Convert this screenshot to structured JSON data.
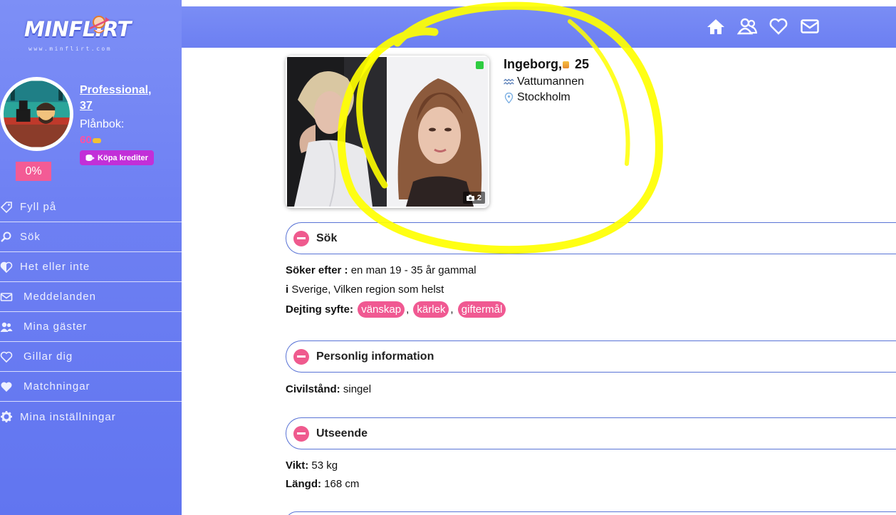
{
  "sidebar": {
    "logo": {
      "text": "MINFLIRT",
      "url": "www.minflirt.com"
    },
    "profile": {
      "name": "Professional, 37",
      "wallet_label": "Plånbok:",
      "wallet_value": "60",
      "buy_button": "Köpa krediter",
      "percent": "0%"
    },
    "menu": [
      {
        "label": "Fyll på",
        "icon": "tag-icon"
      },
      {
        "label": "Sök",
        "icon": "search-icon"
      },
      {
        "label": "Het eller inte",
        "icon": "half-heart-icon"
      },
      {
        "label": "Meddelanden",
        "icon": "envelope-icon"
      },
      {
        "label": "Mina gäster",
        "icon": "users-icon"
      },
      {
        "label": "Gillar dig",
        "icon": "heart-outline-icon"
      },
      {
        "label": "Matchningar",
        "icon": "heart-icon"
      },
      {
        "label": "Mina inställningar",
        "icon": "gear-icon"
      }
    ]
  },
  "topbar": {
    "icons": [
      "home-icon",
      "users-icon",
      "heart-outline-icon",
      "envelope-icon"
    ]
  },
  "user": {
    "name": "Ingeborg,",
    "age": "25",
    "zodiac": "Vattumannen",
    "city": "Stockholm",
    "photo_count": "2",
    "online": true
  },
  "sections": {
    "search": {
      "title": "Sök",
      "seeking_label": "Söker efter :",
      "seeking_value": "en man 19 - 35 år gammal",
      "location_label": "i",
      "location_value": "Sverige, Vilken region som helst",
      "purpose_label": "Dejting syfte:",
      "purposes": [
        "vänskap",
        "kärlek",
        "giftermål"
      ]
    },
    "personal": {
      "title": "Personlig information",
      "civil_label": "Civilstånd:",
      "civil_value": "singel"
    },
    "appearance": {
      "title": "Utseende",
      "weight_label": "Vikt:",
      "weight_value": "53 kg",
      "height_label": "Längd:",
      "height_value": "168 cm"
    }
  },
  "colors": {
    "sidebar": "#6e80f3",
    "accent_pink": "#f05992",
    "buy_button": "#c22fd8",
    "highlight_marker": "#ffff00",
    "online": "#2ecc40"
  }
}
